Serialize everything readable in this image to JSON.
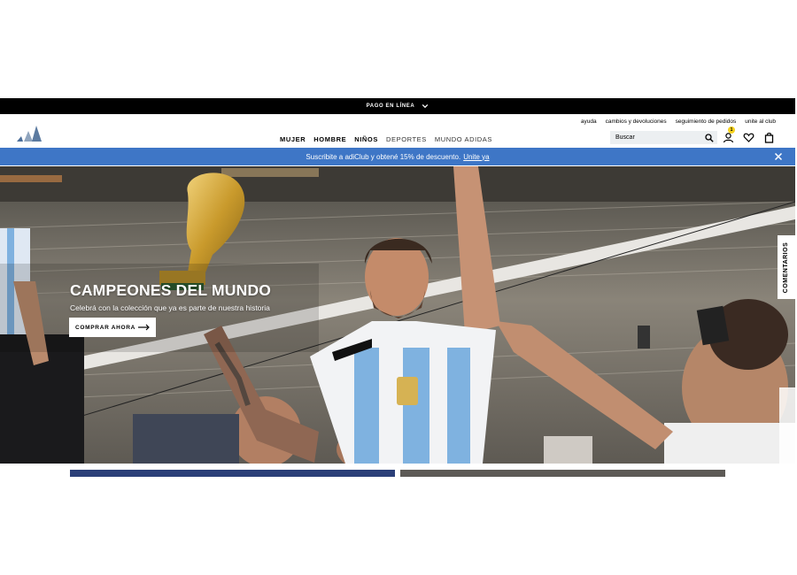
{
  "topbar": {
    "text": "PAGO EN LÍNEA"
  },
  "utility_links": [
    "ayuda",
    "cambios y devoluciones",
    "seguimiento de pedidos",
    "unite al club"
  ],
  "nav": [
    {
      "label": "MUJER",
      "weight": "bold"
    },
    {
      "label": "HOMBRE",
      "weight": "bold"
    },
    {
      "label": "NIÑOS",
      "weight": "bold"
    },
    {
      "label": "DEPORTES",
      "weight": "light"
    },
    {
      "label": "MUNDO ADIDAS",
      "weight": "light"
    }
  ],
  "search": {
    "placeholder": "Buscar",
    "value": ""
  },
  "header_icons": {
    "account_badge": "1"
  },
  "promo": {
    "text": "Suscribite a adiClub y obtené 15% de descuento.",
    "link": "Unite ya"
  },
  "hero": {
    "title": "CAMPEONES DEL MUNDO",
    "subtitle": "Celebrá con la colección que ya es parte de nuestra historia",
    "cta": "COMPRAR AHORA"
  },
  "side_tab": {
    "label": "COMENTARIOS"
  },
  "colors": {
    "promo": "#3e76c6",
    "topbar": "#000000",
    "badge": "#f5d11d"
  }
}
